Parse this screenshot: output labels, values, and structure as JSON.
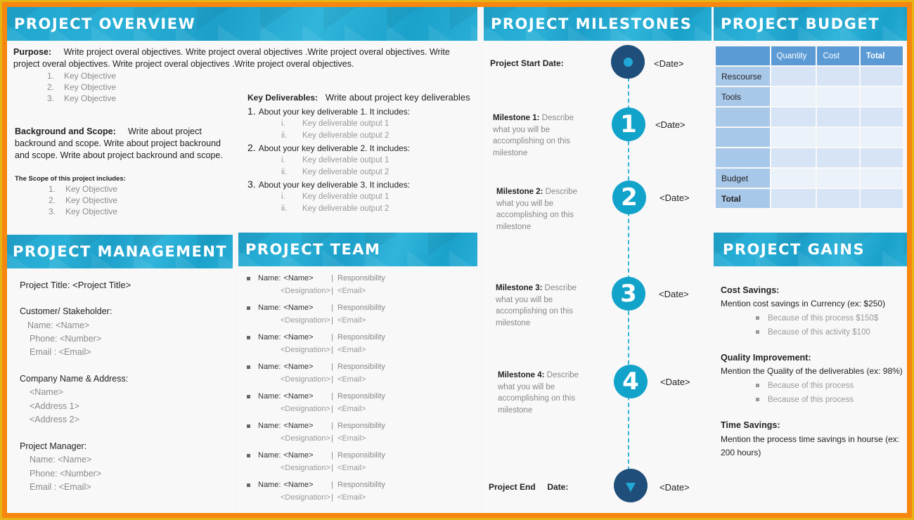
{
  "colors": {
    "outer": "#e6b417",
    "border": "#f7870f",
    "header": "#1fa6cf",
    "dark_circle": "#1f4e7a",
    "blue_circle": "#12a3cb",
    "table_header": "#5b9bd5"
  },
  "overview": {
    "title": "PROJECT OVERVIEW",
    "purpose_label": "Purpose:",
    "purpose_text": "Write project overal objectives. Write project overal objectives .Write project overal objectives. Write project overal objectives. Write project overal objectives .Write project overal objectives.",
    "objectives": [
      {
        "n": "1.",
        "text": "Key Objective"
      },
      {
        "n": "2.",
        "text": "Key Objective"
      },
      {
        "n": "3.",
        "text": "Key Objective"
      }
    ],
    "background_label": "Background and Scope:",
    "background_text": "Write about project backround and scope. Write about project backround and scope. Write about project backround and scope.",
    "scope_label": "The Scope of this project includes:",
    "scope_items": [
      {
        "n": "1.",
        "text": "Key Objective"
      },
      {
        "n": "2.",
        "text": "Key Objective"
      },
      {
        "n": "3.",
        "text": "Key Objective"
      }
    ],
    "deliverables_label": "Key Deliverables:",
    "deliverables_text": "Write about project key deliverables",
    "deliverables": [
      {
        "n": "1.",
        "text": "About your key deliverable 1. It includes:",
        "outputs": [
          {
            "n": "i.",
            "text": "Key deliverable output 1"
          },
          {
            "n": "ii.",
            "text": "Key deliverable output 2"
          }
        ]
      },
      {
        "n": "2.",
        "text": "About your key deliverable 2. It includes:",
        "outputs": [
          {
            "n": "i.",
            "text": "Key deliverable output 1"
          },
          {
            "n": "ii.",
            "text": "Key deliverable output 2"
          }
        ]
      },
      {
        "n": "3.",
        "text": "About your key deliverable 3. It includes:",
        "outputs": [
          {
            "n": "i.",
            "text": "Key deliverable output 1"
          },
          {
            "n": "ii.",
            "text": "Key deliverable output 2"
          }
        ]
      }
    ]
  },
  "management": {
    "title": "PROJECT MANAGEMENT",
    "project_title": "Project Title: <Project Title>",
    "customer_label": "Customer/ Stakeholder:",
    "customer_name": "Name: <Name>",
    "customer_phone": "Phone: <Number>",
    "customer_email": "Email : <Email>",
    "company_label": "Company Name &  Address:",
    "company_name": "<Name>",
    "company_address1": "<Address 1>",
    "company_address2": "<Address 2>",
    "manager_label": "Project Manager:",
    "manager_name": "Name: <Name>",
    "manager_phone": "Phone: <Number>",
    "manager_email": "Email : <Email>"
  },
  "team": {
    "title": "PROJECT TEAM",
    "members": [
      {
        "name_label": "Name:",
        "name": "<Name>",
        "sep": "|",
        "responsibility": "Responsibility",
        "designation": "<Designation>",
        "email": "<Email>"
      },
      {
        "name_label": "Name:",
        "name": "<Name>",
        "sep": "|",
        "responsibility": "Responsibility",
        "designation": "<Designation>",
        "email": "<Email>"
      },
      {
        "name_label": "Name:",
        "name": "<Name>",
        "sep": "|",
        "responsibility": "Responsibility",
        "designation": "<Designation>",
        "email": "<Email>"
      },
      {
        "name_label": "Name:",
        "name": "<Name>",
        "sep": "|",
        "responsibility": "Responsibility",
        "designation": "<Designation>",
        "email": "<Email>"
      },
      {
        "name_label": "Name:",
        "name": "<Name>",
        "sep": "|",
        "responsibility": "Responsibility",
        "designation": "<Designation>",
        "email": "<Email>"
      },
      {
        "name_label": "Name:",
        "name": "<Name>",
        "sep": "|",
        "responsibility": "Responsibility",
        "designation": "<Designation>",
        "email": "<Email>"
      },
      {
        "name_label": "Name:",
        "name": "<Name>",
        "sep": "|",
        "responsibility": "Responsibility",
        "designation": "<Designation>",
        "email": "<Email>"
      },
      {
        "name_label": "Name:",
        "name": "<Name>",
        "sep": "|",
        "responsibility": "Responsibility",
        "designation": "<Designation>",
        "email": "<Email>"
      }
    ]
  },
  "milestones": {
    "title": "PROJECT MILESTONES",
    "start_label": "Project Start Date:",
    "start_date": "<Date>",
    "items": [
      {
        "number": "1",
        "label": "Milestone 1:",
        "desc": "Describe what you will be accomplishing on this milestone",
        "date": "<Date>"
      },
      {
        "number": "2",
        "label": "Milestone 2:",
        "desc": "Describe what you will be accomplishing on this milestone",
        "date": "<Date>"
      },
      {
        "number": "3",
        "label": "Milestone 3:",
        "desc": "Describe what you will be accomplishing on this milestone",
        "date": "<Date>"
      },
      {
        "number": "4",
        "label": "Milestone 4:",
        "desc": "Describe what you will be accomplishing on this milestone",
        "date": "<Date>"
      }
    ],
    "end_label": "Project End     Date:",
    "end_date": "<Date>"
  },
  "budget": {
    "title": "PROJECT BUDGET",
    "columns": [
      "",
      "Quantity",
      "Cost",
      "Total"
    ],
    "rows": [
      {
        "label": "Rescourse",
        "bold": false
      },
      {
        "label": "Tools",
        "bold": false
      },
      {
        "label": "",
        "bold": false
      },
      {
        "label": "",
        "bold": false
      },
      {
        "label": "",
        "bold": false
      },
      {
        "label": "Budget",
        "bold": false
      },
      {
        "label": "Total",
        "bold": true
      }
    ]
  },
  "gains": {
    "title": "PROJECT GAINS",
    "cost_label": "Cost Savings:",
    "cost_text": "Mention cost savings in Currency (ex: $250)",
    "cost_items": [
      "Because of  this process $150$",
      "Because of  this activity  $100"
    ],
    "quality_label": "Quality Improvement:",
    "quality_text": "Mention the Quality of  the deliverables (ex: 98%)",
    "quality_items": [
      "Because of  this process",
      "Because of  this process"
    ],
    "time_label": "Time Savings:",
    "time_text": "Mention the process  time savings in hourse (ex: 200 hours)"
  }
}
